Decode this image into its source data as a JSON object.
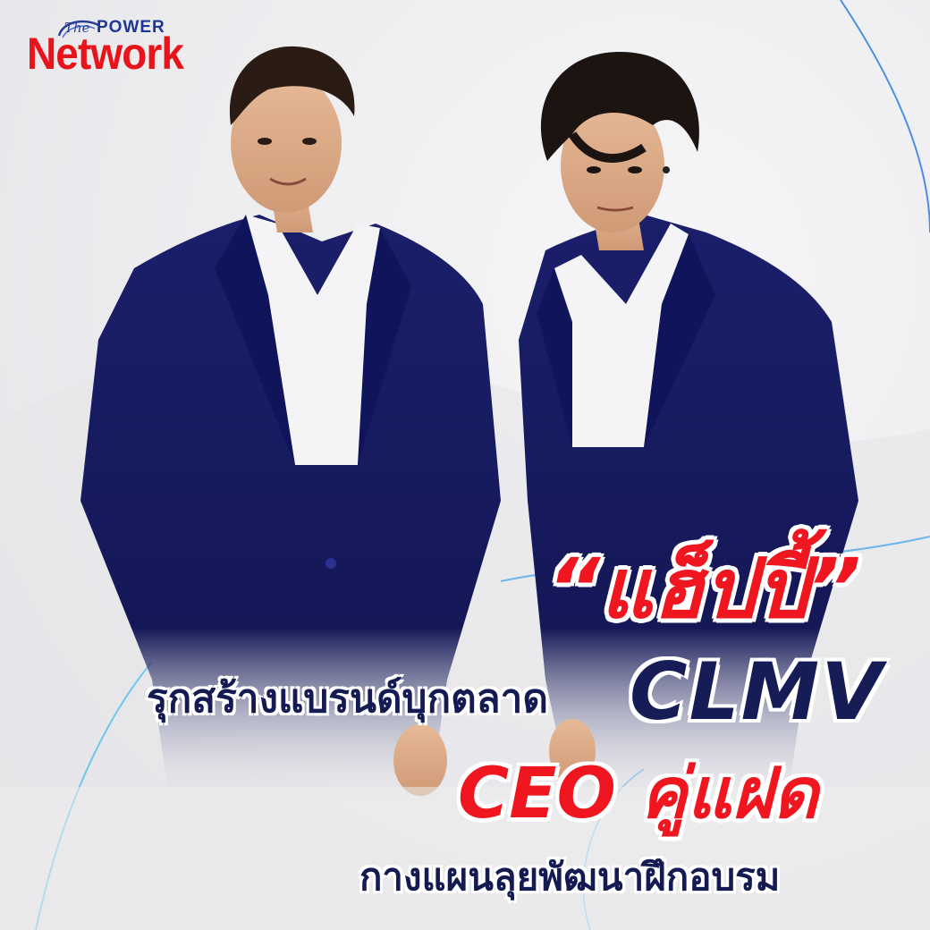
{
  "logo": {
    "the": "The",
    "power": "POWER",
    "network": "Network"
  },
  "headline": {
    "title": "“แฮ็ปปี้”",
    "line1": "รุกสร้างแบรนด์บุกตลาด",
    "clmv": "CLMV",
    "line2": "CEO คู่แฝด",
    "line3": "กางแผนลุยพัฒนาฝึกอบรม"
  },
  "colors": {
    "brand_red": "#ef1620",
    "navy_text": "#141a52",
    "suit_navy": "#161a5e",
    "accent_blue": "#5aa6e6"
  }
}
